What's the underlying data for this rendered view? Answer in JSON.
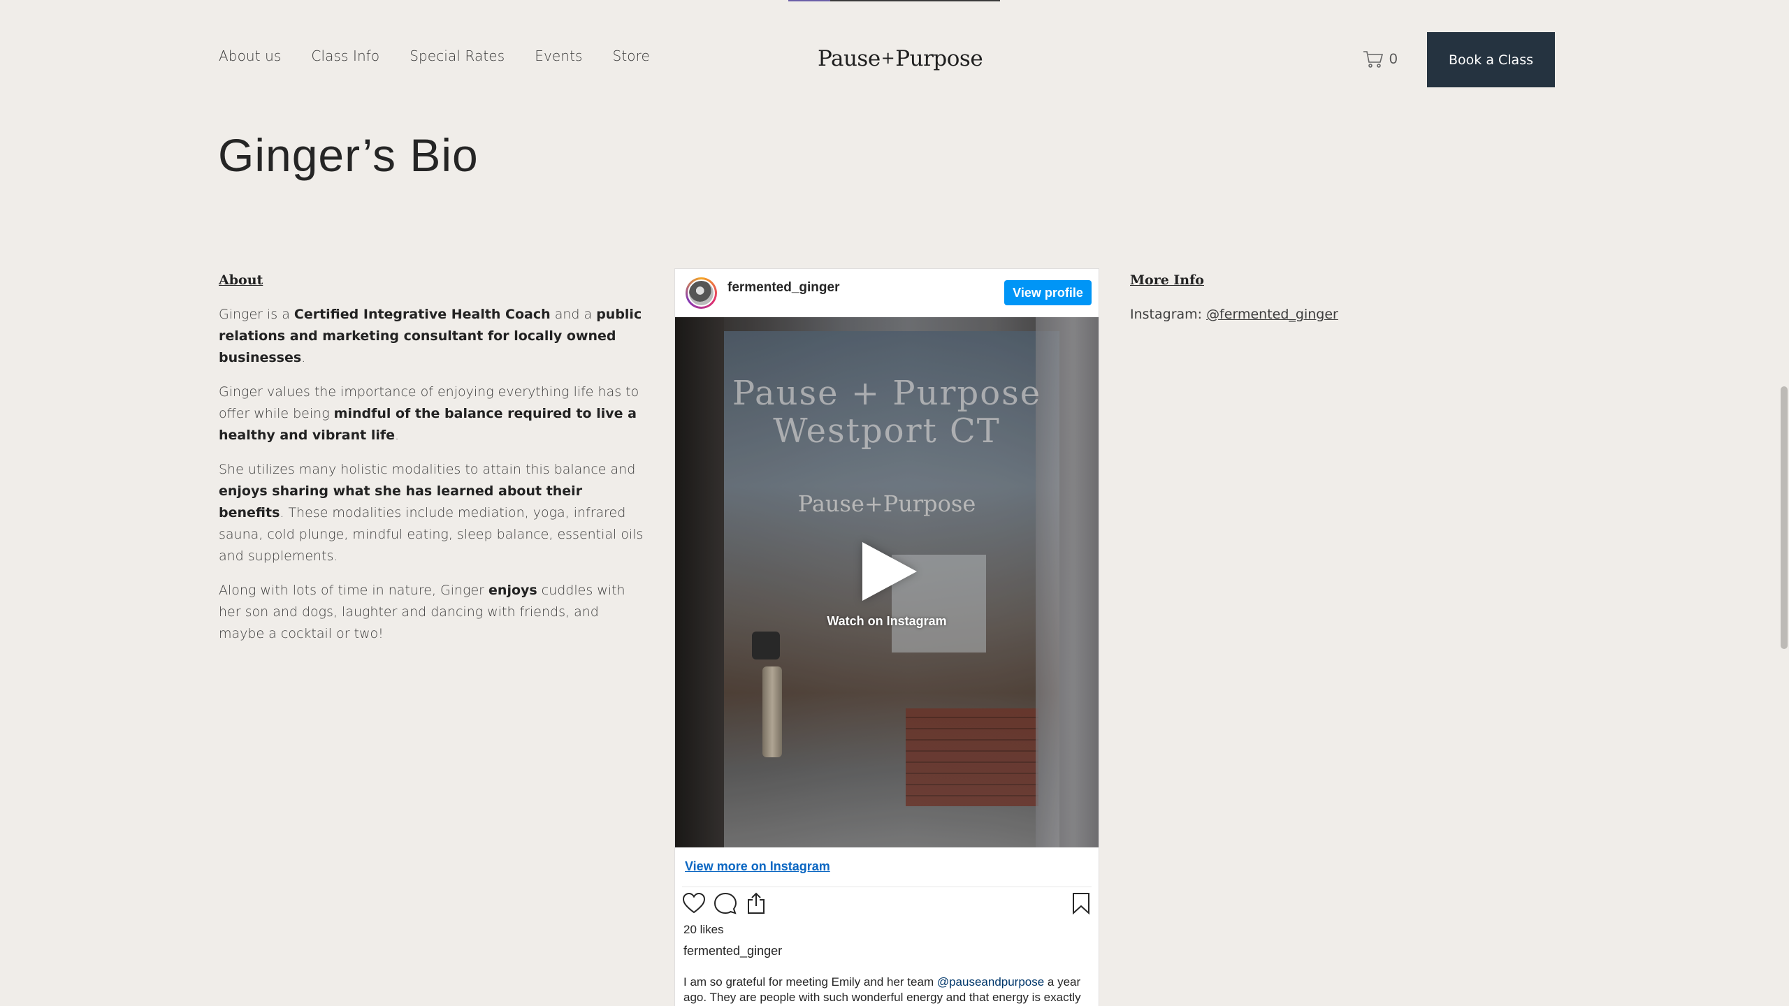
{
  "nav": {
    "items": [
      "About us",
      "Class Info",
      "Special Rates",
      "Events",
      "Store"
    ]
  },
  "brand": {
    "logo_left": "Pause",
    "logo_plus": "+",
    "logo_right": "Purpose"
  },
  "cart": {
    "count": "0",
    "icon": "cart-icon"
  },
  "header": {
    "book_label": "Book a Class",
    "book_color": "#253340"
  },
  "page": {
    "title": "Ginger’s Bio"
  },
  "about": {
    "heading": "About",
    "p1": {
      "a": "Ginger is a ",
      "b1": "Certified Integrative Health Coach",
      "c": " and a ",
      "b2": "public relations and marketing consultant for locally owned businesses",
      "d": "."
    },
    "p2": {
      "a": "Ginger values the importance of enjoying everything life has to offer while being ",
      "b": "mindful of the balance required to live a healthy and vibrant life",
      "c": "."
    },
    "p3": {
      "a": "She utilizes many holistic modalities to attain this balance and ",
      "b": "enjoys sharing what she has learned about their benefits",
      "c": ". These modalities include mediation, yoga, infrared sauna, cold plunge, mindful eating, sleep balance, essential oils and supplements."
    },
    "p4": {
      "a": "Along with lots of time in nature, Ginger ",
      "b": "enjoys",
      "c": " cuddles with her son and dogs, laughter and dancing with friends, and maybe a cocktail or two!"
    }
  },
  "more_info": {
    "heading": "More Info",
    "label": "Instagram: ",
    "handle": "@fermented_ginger"
  },
  "instagram": {
    "username": "fermented_ginger",
    "view_profile": "View profile",
    "media_line1": "Pause + Purpose",
    "media_line2": "Westport CT",
    "media_logo": "Pause+Purpose",
    "watch_label": "Watch on Instagram",
    "view_more": "View more on Instagram",
    "likes": "20 likes",
    "author": "fermented_ginger",
    "caption_a": "I am so grateful for meeting Emily and her team ",
    "caption_mention": "@pauseandpurpose",
    "caption_b": " a year ago. They are people with such wonderful energy and that energy is exactly",
    "accent_color": "#0095f6"
  }
}
